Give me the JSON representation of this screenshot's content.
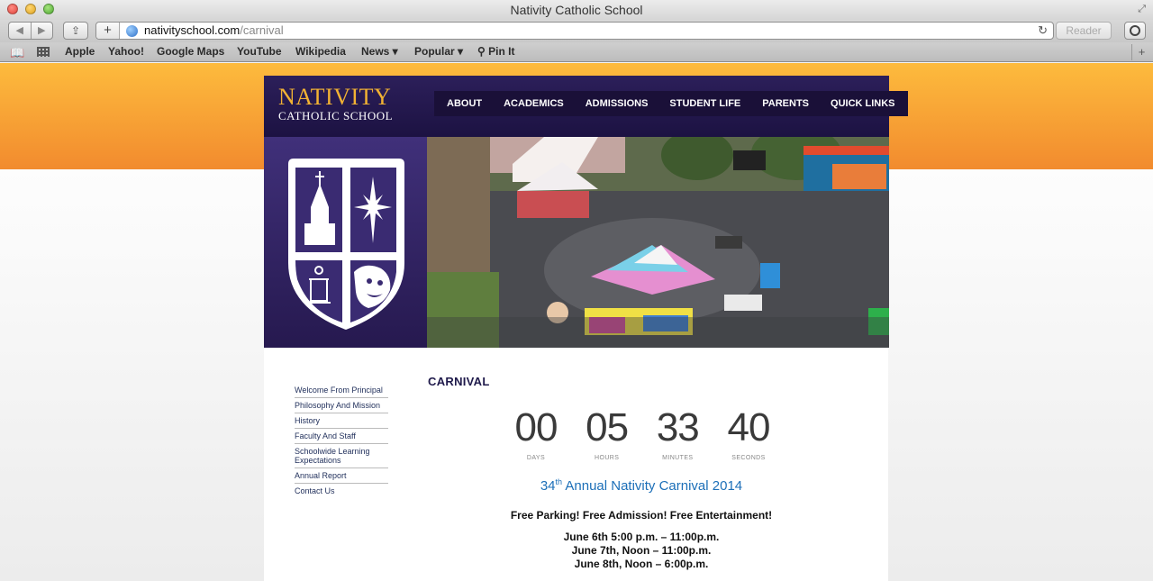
{
  "browser": {
    "window_title": "Nativity Catholic School",
    "url_host": "nativityschool.com",
    "url_path": "/carnival",
    "reader_label": "Reader",
    "bookmarks": [
      "Apple",
      "Yahoo!",
      "Google Maps",
      "YouTube",
      "Wikipedia",
      "News ▾",
      "Popular ▾",
      "⚲ Pin It"
    ]
  },
  "site": {
    "logo_main": "NATIVITY",
    "logo_sub": "CATHOLIC SCHOOL",
    "nav": [
      "ABOUT",
      "ACADEMICS",
      "ADMISSIONS",
      "STUDENT LIFE",
      "PARENTS",
      "QUICK LINKS"
    ]
  },
  "sidebar": {
    "items": [
      "Welcome From Principal",
      "Philosophy And Mission",
      "History",
      "Faculty And Staff",
      "Schoolwide Learning Expectations",
      "Annual Report",
      "Contact Us"
    ]
  },
  "main": {
    "title": "CARNIVAL",
    "countdown": [
      {
        "value": "00",
        "label": "DAYS"
      },
      {
        "value": "05",
        "label": "HOURS"
      },
      {
        "value": "33",
        "label": "MINUTES"
      },
      {
        "value": "40",
        "label": "SECONDS"
      }
    ],
    "event_ordinal": "34",
    "event_suffix": "th",
    "event_title_rest": "Annual Nativity Carnival 2014",
    "event_sub": "Free Parking! Free Admission! Free Entertainment!",
    "dates": [
      "June 6th 5:00 p.m. – 11:00p.m.",
      "June 7th, Noon – 11:00p.m.",
      "June 8th, Noon – 6:00p.m."
    ]
  },
  "colors": {
    "orange_top": "#fdbb3d",
    "orange_bottom": "#f28b2e",
    "header_purple": "#2c1f5a",
    "logo_gold": "#f2b233",
    "event_blue": "#1c6fb8"
  }
}
